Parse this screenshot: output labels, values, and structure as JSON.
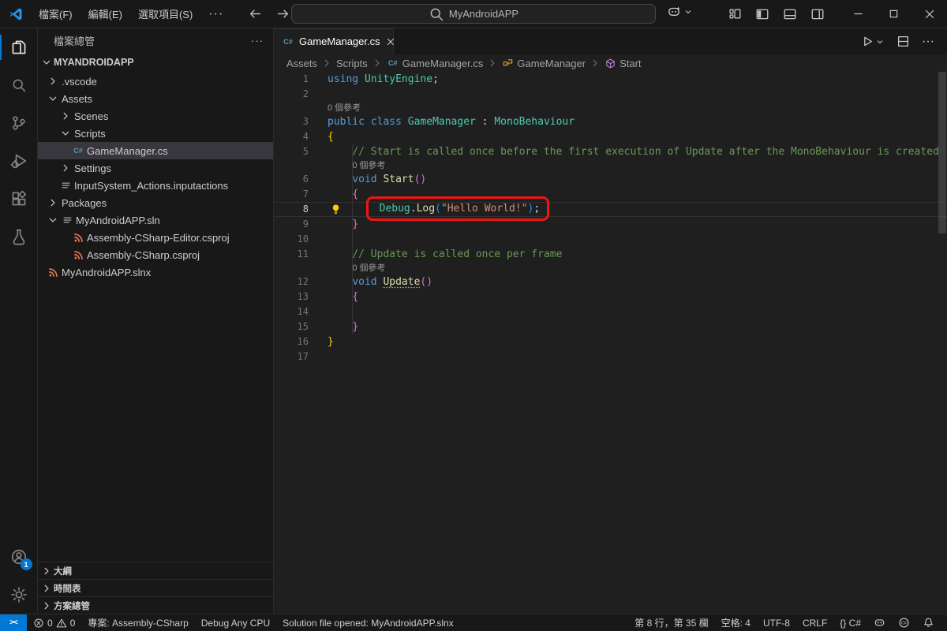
{
  "title_bar": {
    "menus": [
      "檔案(F)",
      "編輯(E)",
      "選取項目(S)"
    ],
    "more_label": "···",
    "search_text": "MyAndroidAPP"
  },
  "activity_bar": {
    "top": [
      {
        "name": "explorer",
        "icon": "files-icon",
        "active": true
      },
      {
        "name": "search",
        "icon": "search-icon",
        "active": false
      },
      {
        "name": "source-control",
        "icon": "source-control-icon",
        "active": false
      },
      {
        "name": "run-debug",
        "icon": "debug-icon",
        "active": false
      },
      {
        "name": "extensions",
        "icon": "extensions-icon",
        "active": false
      },
      {
        "name": "testing",
        "icon": "beaker-icon",
        "active": false
      }
    ],
    "bottom": [
      {
        "name": "accounts",
        "icon": "account-icon",
        "badge": "1"
      },
      {
        "name": "settings",
        "icon": "gear-icon"
      }
    ]
  },
  "sidebar": {
    "title": "檔案總管",
    "root_label": "MYANDROIDAPP",
    "tree": [
      {
        "label": ".vscode",
        "level": 0,
        "kind": "folder",
        "expanded": false
      },
      {
        "label": "Assets",
        "level": 0,
        "kind": "folder",
        "expanded": true
      },
      {
        "label": "Scenes",
        "level": 1,
        "kind": "folder",
        "expanded": false
      },
      {
        "label": "Scripts",
        "level": 1,
        "kind": "folder",
        "expanded": true
      },
      {
        "label": "GameManager.cs",
        "level": 2,
        "kind": "file",
        "icon": "csharp-file-icon",
        "selected": true
      },
      {
        "label": "Settings",
        "level": 1,
        "kind": "folder",
        "expanded": false
      },
      {
        "label": "InputSystem_Actions.inputactions",
        "level": 1,
        "kind": "file",
        "icon": "list-file-icon"
      },
      {
        "label": "Packages",
        "level": 0,
        "kind": "folder",
        "expanded": false
      },
      {
        "label": "MyAndroidAPP.sln",
        "level": 0,
        "kind": "expandable-file",
        "icon": "list-file-icon",
        "expanded": true
      },
      {
        "label": "Assembly-CSharp-Editor.csproj",
        "level": 2,
        "kind": "file",
        "icon": "rss-file-icon"
      },
      {
        "label": "Assembly-CSharp.csproj",
        "level": 2,
        "kind": "file",
        "icon": "rss-file-icon"
      },
      {
        "label": "MyAndroidAPP.slnx",
        "level": 0,
        "kind": "file",
        "icon": "rss-file-icon"
      }
    ],
    "bottom_sections": [
      "大綱",
      "時間表",
      "方案總管"
    ]
  },
  "editor": {
    "tab": {
      "label": "GameManager.cs",
      "icon": "csharp-file-icon"
    },
    "breadcrumbs": [
      {
        "label": "Assets"
      },
      {
        "label": "Scripts"
      },
      {
        "label": "GameManager.cs",
        "icon": "csharp-file-icon"
      },
      {
        "label": "GameManager",
        "icon": "class-symbol-icon"
      },
      {
        "label": "Start",
        "icon": "method-symbol-icon"
      }
    ],
    "codelens_label": "0 個參考",
    "lines": [
      {
        "n": 1,
        "seg": [
          [
            "using",
            "kw"
          ],
          [
            " ",
            "pl"
          ],
          [
            "UnityEngine",
            "ty"
          ],
          [
            ";",
            "pl"
          ]
        ]
      },
      {
        "n": 2,
        "seg": []
      },
      {
        "n": 3,
        "lens": 0,
        "seg": [
          [
            "public",
            "kw"
          ],
          [
            " ",
            "pl"
          ],
          [
            "class",
            "kw"
          ],
          [
            " ",
            "pl"
          ],
          [
            "GameManager",
            "ty"
          ],
          [
            " : ",
            "pl"
          ],
          [
            "MonoBehaviour",
            "ty"
          ]
        ]
      },
      {
        "n": 4,
        "seg": [
          [
            "{",
            "b1"
          ]
        ]
      },
      {
        "n": 5,
        "seg": [
          [
            "    ",
            "pl"
          ],
          [
            "// Start is called once before the first execution of Update after the MonoBehaviour is created",
            "co"
          ]
        ]
      },
      {
        "n": 6,
        "lens": 4,
        "seg": [
          [
            "    ",
            "pl"
          ],
          [
            "void",
            "kw"
          ],
          [
            " ",
            "pl"
          ],
          [
            "Start",
            "fn"
          ],
          [
            "()",
            "b2"
          ]
        ]
      },
      {
        "n": 7,
        "seg": [
          [
            "    ",
            "pl"
          ],
          [
            "{",
            "b2"
          ]
        ]
      },
      {
        "n": 8,
        "current": true,
        "bulb": true,
        "box_from": 1,
        "seg": [
          [
            "        ",
            "pl"
          ],
          [
            "Debug",
            "ty"
          ],
          [
            ".",
            "pl"
          ],
          [
            "Log",
            "fn"
          ],
          [
            "(",
            "b3"
          ],
          [
            "\"Hello World!\"",
            "st"
          ],
          [
            ")",
            "b3"
          ],
          [
            ";",
            "pl"
          ]
        ]
      },
      {
        "n": 9,
        "seg": [
          [
            "    ",
            "pl"
          ],
          [
            "}",
            "b2"
          ]
        ]
      },
      {
        "n": 10,
        "seg": []
      },
      {
        "n": 11,
        "seg": [
          [
            "    ",
            "pl"
          ],
          [
            "// Update is called once per frame",
            "co"
          ]
        ]
      },
      {
        "n": 12,
        "lens": 4,
        "seg": [
          [
            "    ",
            "pl"
          ],
          [
            "void",
            "kw"
          ],
          [
            " ",
            "pl"
          ],
          [
            "Update",
            "fn",
            "u"
          ],
          [
            "()",
            "b2"
          ]
        ]
      },
      {
        "n": 13,
        "seg": [
          [
            "    ",
            "pl"
          ],
          [
            "{",
            "b2"
          ]
        ]
      },
      {
        "n": 14,
        "seg": []
      },
      {
        "n": 15,
        "seg": [
          [
            "    ",
            "pl"
          ],
          [
            "}",
            "b2"
          ]
        ]
      },
      {
        "n": 16,
        "seg": [
          [
            "}",
            "b1"
          ]
        ]
      },
      {
        "n": 17,
        "seg": []
      }
    ]
  },
  "status_bar": {
    "remote_glyph": "><",
    "left": [
      {
        "name": "problems",
        "parts": [
          {
            "icon": "error-icon",
            "text": "0"
          },
          {
            "icon": "warning-icon",
            "text": "0"
          }
        ]
      },
      {
        "name": "project",
        "text": "專案: Assembly-CSharp"
      },
      {
        "name": "build-config",
        "text": "Debug Any CPU"
      },
      {
        "name": "solution-status",
        "text": "Solution file opened: MyAndroidAPP.slnx"
      }
    ],
    "right": [
      {
        "name": "cursor-position",
        "text": "第 8 行，第 35 欄"
      },
      {
        "name": "indentation",
        "text": "空格: 4"
      },
      {
        "name": "encoding",
        "text": "UTF-8"
      },
      {
        "name": "eol",
        "text": "CRLF"
      },
      {
        "name": "language-mode",
        "text": "{} C#"
      },
      {
        "name": "copilot-status",
        "icon": "copilot-face-icon"
      },
      {
        "name": "csharp-status",
        "icon": "dotnet-icon"
      },
      {
        "name": "notifications",
        "icon": "bell-icon"
      }
    ]
  },
  "colors": {
    "accent": "#0078d4",
    "annotation_box": "#f01414",
    "editor_bg": "#1f1f1f",
    "panel_bg": "#181818",
    "selection_bg": "#37373d",
    "syntax": {
      "keyword": "#569cd6",
      "type": "#4ec9b0",
      "method": "#dcdcaa",
      "string": "#ce9178",
      "comment": "#6a9955",
      "plain": "#d4d4d4",
      "bracket1": "#ffd700",
      "bracket2": "#da70d6",
      "bracket3": "#179fff"
    }
  }
}
